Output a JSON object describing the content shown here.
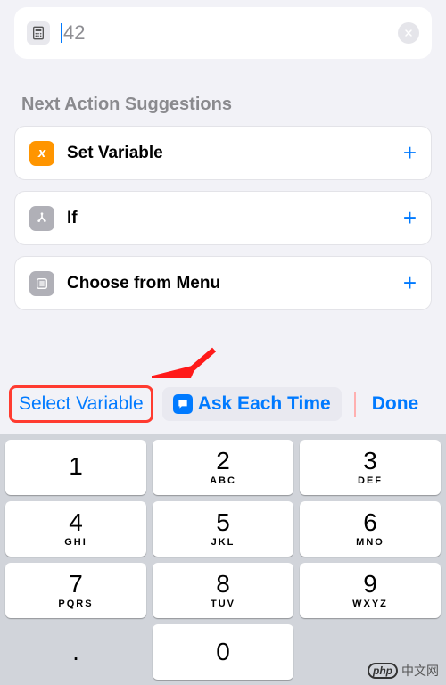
{
  "input": {
    "icon": "calculator-icon",
    "value": "42",
    "clear_label": "✕"
  },
  "suggestions_title": "Next Action Suggestions",
  "suggestions": [
    {
      "icon": "variable-x-icon",
      "label": "Set Variable"
    },
    {
      "icon": "branch-icon",
      "label": "If"
    },
    {
      "icon": "menu-list-icon",
      "label": "Choose from Menu"
    }
  ],
  "variable_bar": {
    "select_label": "Select Variable",
    "ask_label": "Ask Each Time",
    "done_label": "Done"
  },
  "keypad": {
    "keys": [
      {
        "num": "1",
        "letters": ""
      },
      {
        "num": "2",
        "letters": "ABC"
      },
      {
        "num": "3",
        "letters": "DEF"
      },
      {
        "num": "4",
        "letters": "GHI"
      },
      {
        "num": "5",
        "letters": "JKL"
      },
      {
        "num": "6",
        "letters": "MNO"
      },
      {
        "num": "7",
        "letters": "PQRS"
      },
      {
        "num": "8",
        "letters": "TUV"
      },
      {
        "num": "9",
        "letters": "WXYZ"
      },
      {
        "num": ".",
        "letters": ""
      },
      {
        "num": "0",
        "letters": ""
      }
    ]
  },
  "watermark": {
    "logo": "php",
    "text": "中文网"
  }
}
